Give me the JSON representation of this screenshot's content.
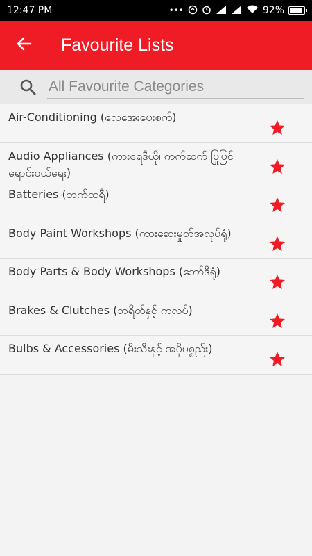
{
  "status_bar": {
    "time": "12:47 PM",
    "battery_percent": "92%",
    "battery_level": 0.92,
    "icons": [
      "more-dots-icon",
      "data-saver-icon",
      "alarm-icon",
      "signal-icon",
      "signal-icon",
      "wifi-icon",
      "battery-icon"
    ]
  },
  "app_bar": {
    "title": "Favourite Lists",
    "back_icon": "arrow-left-icon",
    "background": "#ef1c26"
  },
  "search": {
    "placeholder": "All Favourite Categories",
    "value": "",
    "icon": "search-icon"
  },
  "list": {
    "items": [
      {
        "label": "Air-Conditioning (လေအေးပေးစက်)",
        "favorited": true
      },
      {
        "label": "Audio Appliances (ကားရေဒီယို၊ ကက်ဆက် ပြုပြင်ရောင်းဝယ်ရေး)",
        "favorited": true
      },
      {
        "label": "Batteries (ဘက်ထရီ)",
        "favorited": true
      },
      {
        "label": "Body Paint Workshops (ကားဆေးမှုတ်အလုပ်ရုံ)",
        "favorited": true
      },
      {
        "label": "Body Parts & Body Workshops (ဘော်ဒီရုံ)",
        "favorited": true
      },
      {
        "label": "Brakes & Clutches (ဘရိတ်နှင့် ကလပ်)",
        "favorited": true
      },
      {
        "label": "Bulbs & Accessories (မီးသီးနှင့် အပိုပစ္စည်း)",
        "favorited": true
      }
    ],
    "star_color": "#ef1c26"
  }
}
